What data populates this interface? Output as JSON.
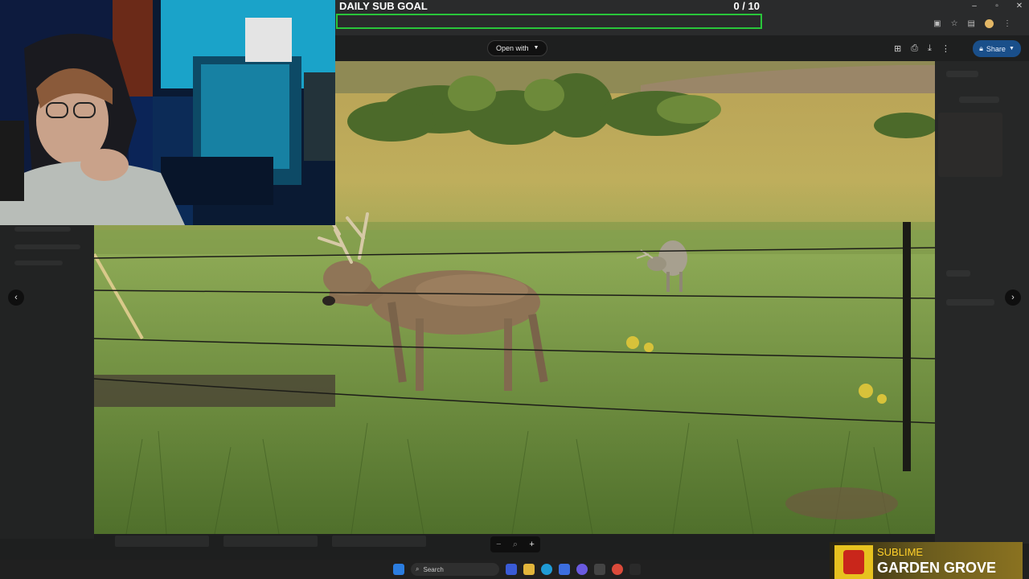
{
  "browser": {
    "window_controls": [
      "–",
      "▫",
      "✕"
    ]
  },
  "viewer": {
    "open_with_label": "Open with",
    "share_label": "Share",
    "prev_arrow": "‹",
    "next_arrow": "›"
  },
  "zoom": {
    "minus": "−",
    "magnifier": "⌕",
    "plus": "+"
  },
  "sub_goal": {
    "title": "DAILY SUB GOAL",
    "count": "0  / 10",
    "progress": 0,
    "color": "#29c63a"
  },
  "taskbar": {
    "search_label": "Search"
  },
  "now_playing": {
    "artist": "SUBLIME",
    "title": "GARDEN GROVE"
  }
}
